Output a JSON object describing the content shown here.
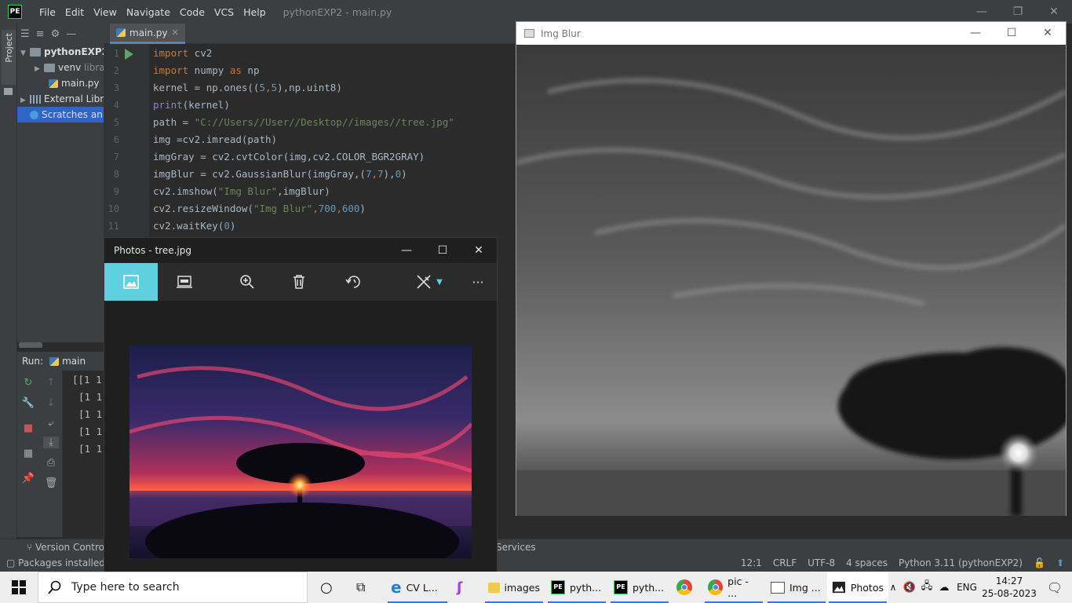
{
  "ide": {
    "logo": "PE",
    "menu": [
      "File",
      "Edit",
      "View",
      "Navigate",
      "Code",
      "VCS",
      "Help"
    ],
    "title": "pythonEXP2 - main.py",
    "project_tab": "Project",
    "tree": {
      "root": "pythonEXP2",
      "venv": "venv",
      "venv_hint": "libra",
      "main_file": "main.py",
      "external": "External Libra",
      "scratches": "Scratches an"
    },
    "editor_tab": "main.py",
    "code_lines": [
      {
        "n": "1",
        "text": ""
      },
      {
        "n": "2",
        "text": ""
      },
      {
        "n": "3",
        "text": ""
      },
      {
        "n": "4",
        "text": ""
      },
      {
        "n": "5",
        "text": ""
      },
      {
        "n": "6",
        "text": ""
      },
      {
        "n": "7",
        "text": ""
      },
      {
        "n": "8",
        "text": ""
      },
      {
        "n": "9",
        "text": ""
      },
      {
        "n": "10",
        "text": ""
      },
      {
        "n": "11",
        "text": ""
      }
    ],
    "code": {
      "l1_kw": "import",
      "l1_rest": " cv2",
      "l2_kw": "import",
      "l2_mid": " numpy ",
      "l2_as": "as",
      "l2_rest": " np",
      "l3_a": "kernel = np.ones((",
      "l3_n1": "5",
      "l3_c": ",",
      "l3_n2": "5",
      "l3_b": "),np.uint8)",
      "l4_bi": "print",
      "l4_rest": "(kernel)",
      "l5_a": "path = ",
      "l5_str": "\"C://Users//User//Desktop//images//tree.jpg\"",
      "l6": "img =cv2.imread(path)",
      "l7": "imgGray = cv2.cvtColor(img,cv2.COLOR_BGR2GRAY)",
      "l8_a": "imgBlur = cv2.GaussianBlur(imgGray,(",
      "l8_n1": "7",
      "l8_c": ",",
      "l8_n2": "7",
      "l8_b": "),",
      "l8_n3": "0",
      "l8_e": ")",
      "l9_a": "cv2.imshow(",
      "l9_str": "\"Img Blur\"",
      "l9_b": ",imgBlur)",
      "l10_a": "cv2.resizeWindow(",
      "l10_str": "\"Img Blur\"",
      "l10_c": ",",
      "l10_n1": "700",
      "l10_c2": ",",
      "l10_n2": "600",
      "l10_e": ")",
      "l11_a": "cv2.waitKey(",
      "l11_n": "0",
      "l11_e": ")"
    },
    "run_label": "Run:",
    "run_tab": "main",
    "console": [
      "[[1 1",
      "[1 1",
      "[1 1",
      "[1 1",
      "[1 1"
    ],
    "version_control": "Version Control",
    "services": "Services",
    "status_msg": "Packages installed su",
    "status": {
      "position": "12:1",
      "line_sep": "CRLF",
      "encoding": "UTF-8",
      "indent": "4 spaces",
      "interpreter": "Python 3.11 (pythonEXP2)"
    }
  },
  "blur_window": {
    "title": "Img Blur",
    "controls": [
      "—",
      "☐",
      "✕"
    ]
  },
  "photos_window": {
    "title": "Photos - tree.jpg",
    "controls": [
      "—",
      "☐",
      "✕"
    ],
    "more": "···"
  },
  "taskbar": {
    "search_placeholder": "Type here to search",
    "items": [
      {
        "label": "CV L..."
      },
      {
        "label": ""
      },
      {
        "label": "images"
      },
      {
        "label": "pyth..."
      },
      {
        "label": "pyth..."
      },
      {
        "label": ""
      },
      {
        "label": "pic - ..."
      },
      {
        "label": "Img ..."
      },
      {
        "label": "Photos"
      }
    ],
    "lang": "ENG",
    "time": "14:27",
    "date": "25-08-2023"
  },
  "colors": {
    "accent": "#3b78d8",
    "photos_accent": "#5fd0e0",
    "ide_bg": "#2b2b2b",
    "ide_panel": "#3c3f41"
  }
}
